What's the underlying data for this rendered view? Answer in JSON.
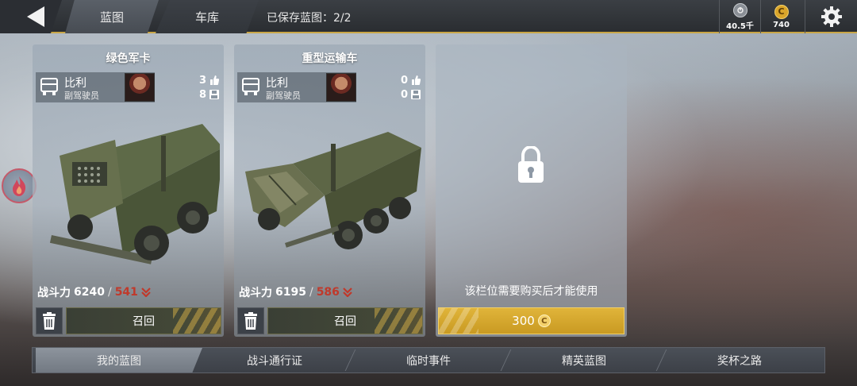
{
  "header": {
    "tabs": [
      {
        "label": "蓝图"
      },
      {
        "label": "车库"
      }
    ],
    "saved_label": "已保存蓝图：2/2",
    "resources": [
      {
        "icon": "gear-token-icon",
        "value": "40.5千"
      },
      {
        "icon": "coin-icon",
        "value": "740"
      }
    ]
  },
  "cards": [
    {
      "title": "绿色军卡",
      "crew_name": "比利",
      "crew_role": "副驾驶员",
      "likes": "3",
      "saves": "8",
      "power_label": "战斗力",
      "power": "6240",
      "power_sep": "/",
      "power_debuff": "541",
      "recall_label": "召回"
    },
    {
      "title": "重型运输车",
      "crew_name": "比利",
      "crew_role": "副驾驶员",
      "likes": "0",
      "saves": "0",
      "power_label": "战斗力",
      "power": "6195",
      "power_sep": "/",
      "power_debuff": "586",
      "recall_label": "召回"
    }
  ],
  "locked_slot": {
    "message": "该栏位需要购买后才能使用",
    "price": "300"
  },
  "bottom_tabs": [
    {
      "label": "我的蓝图"
    },
    {
      "label": "战斗通行证"
    },
    {
      "label": "临时事件"
    },
    {
      "label": "精英蓝图"
    },
    {
      "label": "奖杯之路"
    }
  ],
  "colors": {
    "accent": "#c9a646",
    "debuff": "#c0392b",
    "buy_button": "#d4a52e"
  }
}
